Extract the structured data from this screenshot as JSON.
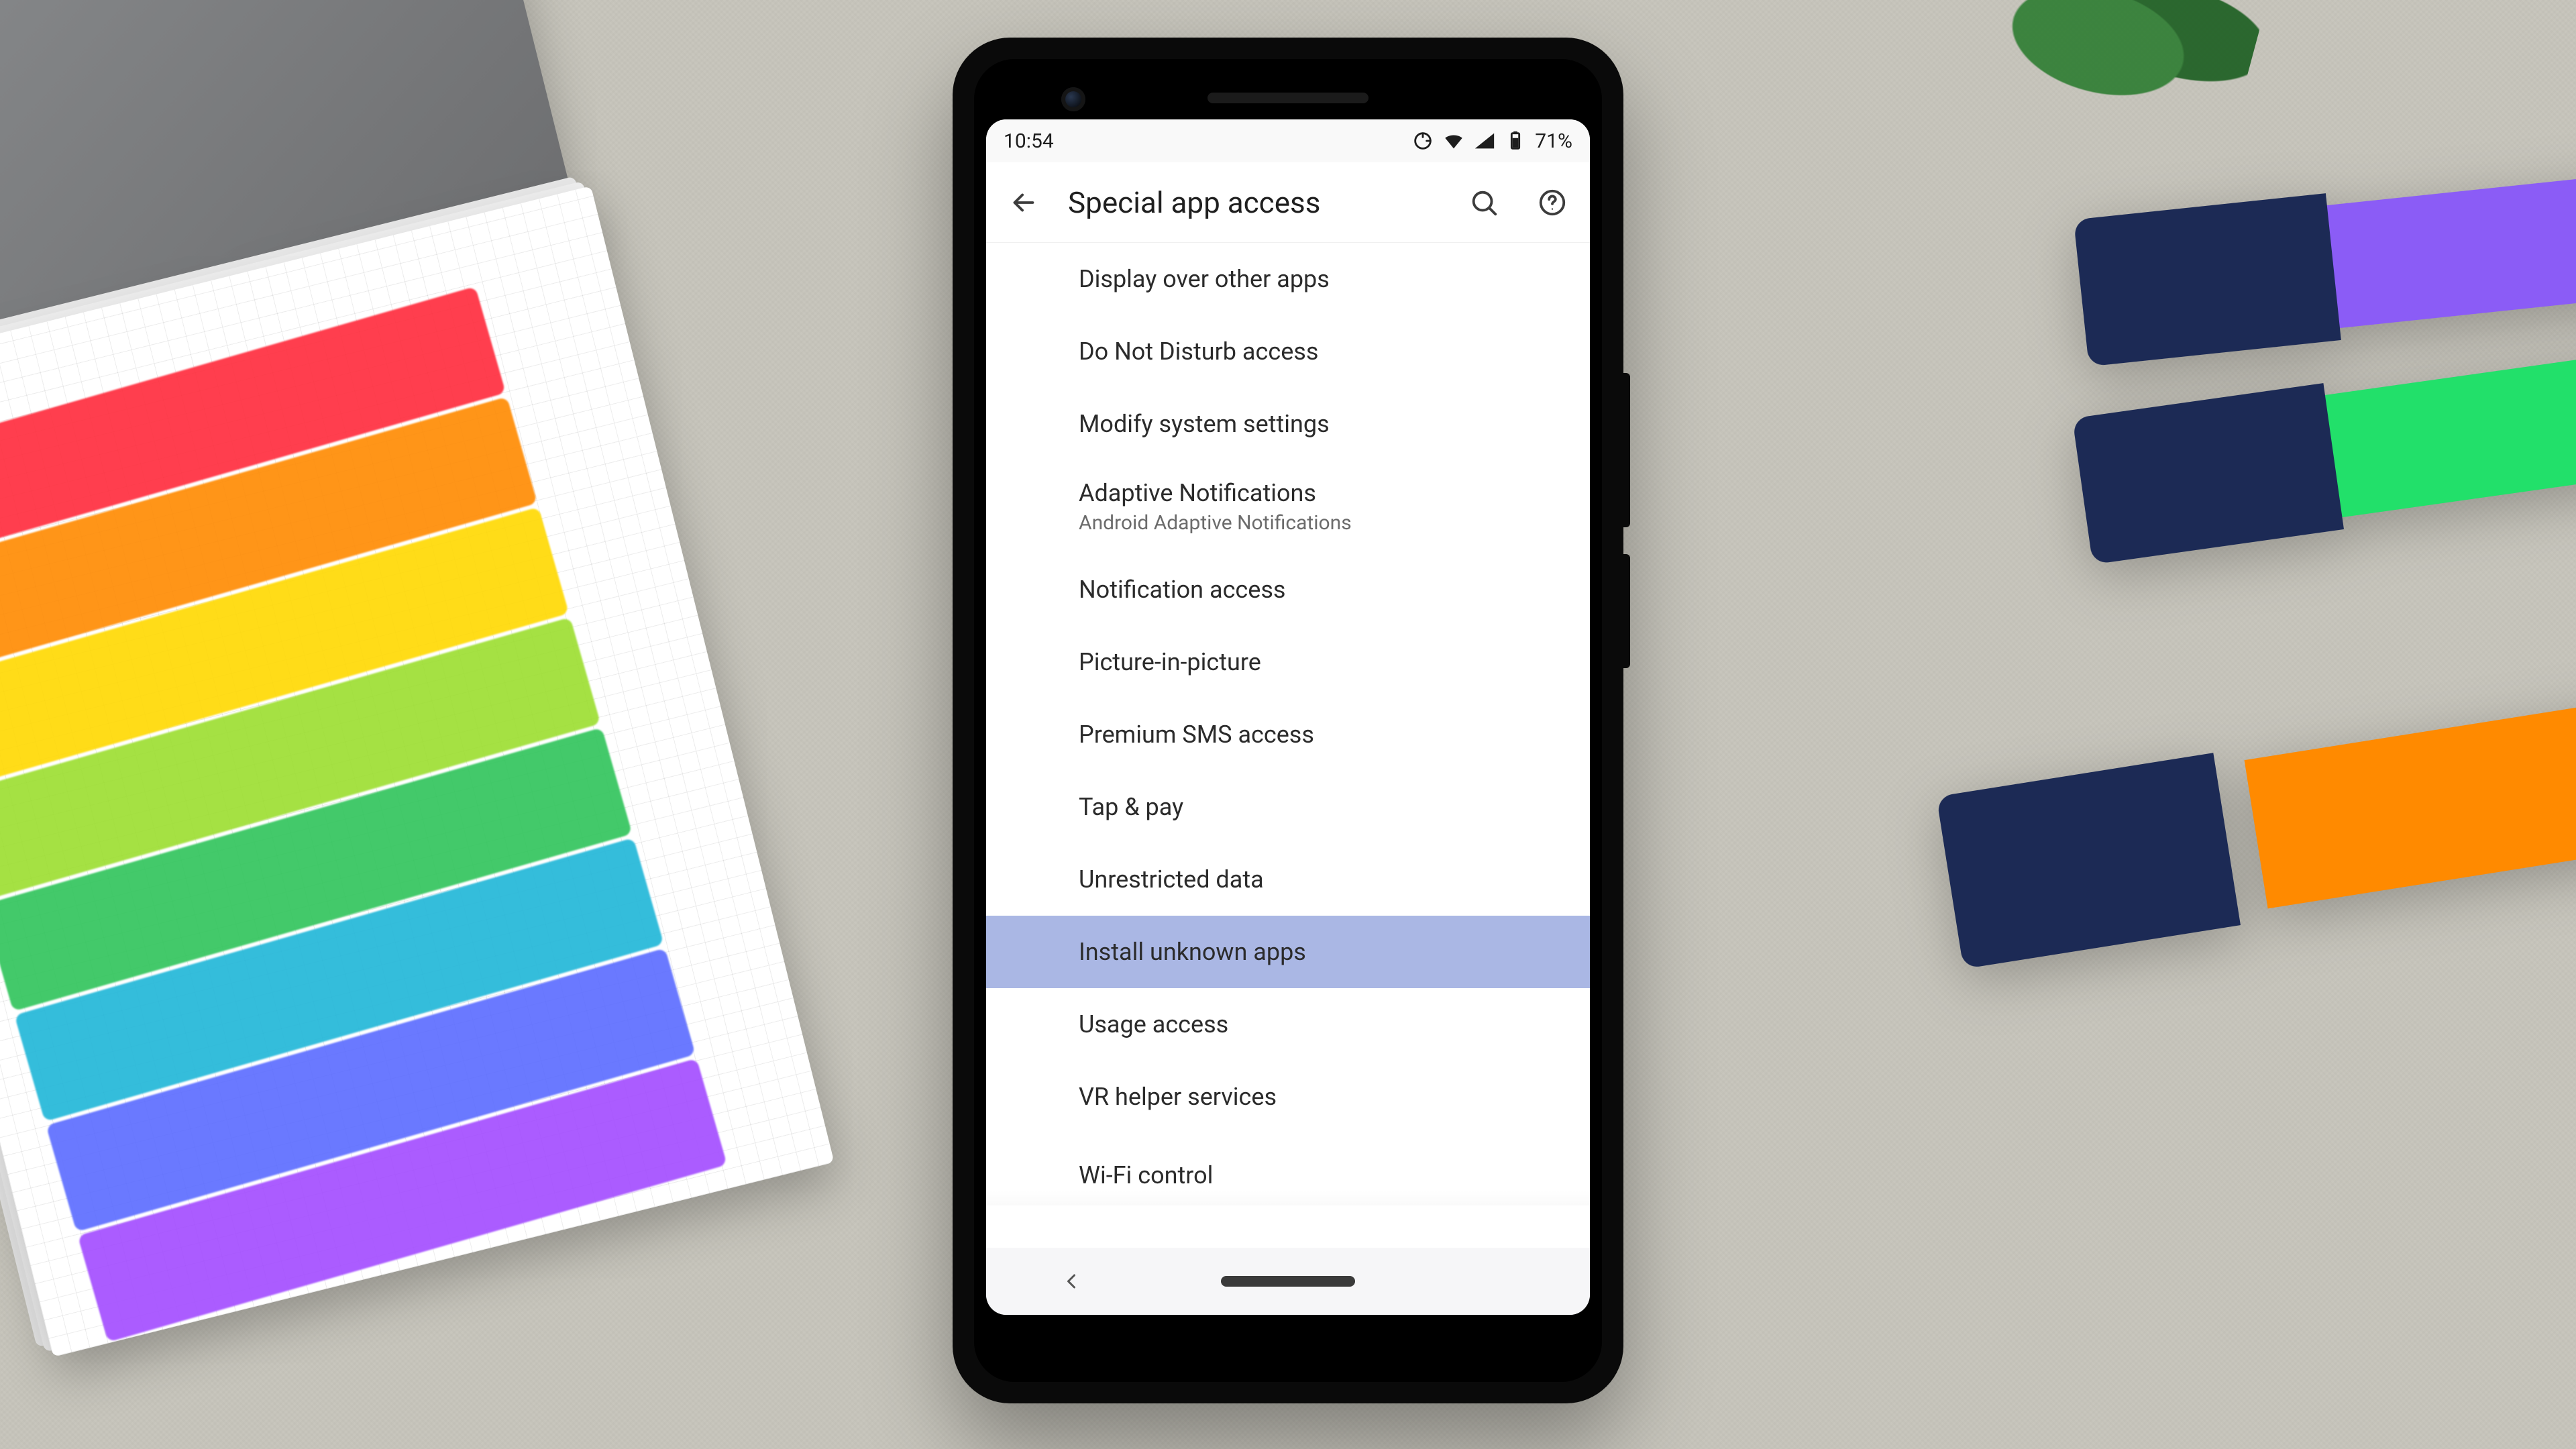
{
  "status": {
    "time": "10:54",
    "battery": "71%"
  },
  "appbar": {
    "title": "Special app access"
  },
  "rows": [
    {
      "primary": "Display over other apps",
      "selected": false
    },
    {
      "primary": "Do Not Disturb access",
      "selected": false
    },
    {
      "primary": "Modify system settings",
      "selected": false
    },
    {
      "primary": "Adaptive Notifications",
      "secondary": "Android Adaptive Notifications",
      "selected": false
    },
    {
      "primary": "Notification access",
      "selected": false
    },
    {
      "primary": "Picture-in-picture",
      "selected": false
    },
    {
      "primary": "Premium SMS access",
      "selected": false
    },
    {
      "primary": "Tap & pay",
      "selected": false
    },
    {
      "primary": "Unrestricted data",
      "selected": false
    },
    {
      "primary": "Install unknown apps",
      "selected": true
    },
    {
      "primary": "Usage access",
      "selected": false
    },
    {
      "primary": "VR helper services",
      "selected": false
    },
    {
      "primary": "Wi-Fi control",
      "selected": false,
      "partial": true
    }
  ]
}
